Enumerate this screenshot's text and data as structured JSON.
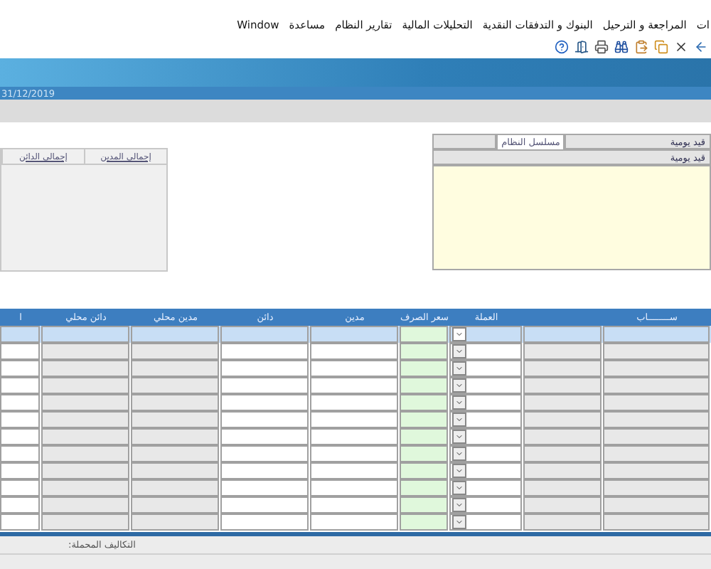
{
  "menu": [
    {
      "label": "ات"
    },
    {
      "label": "المراجعة و الترحيل"
    },
    {
      "label": "البنوك و التدفقات النقدية"
    },
    {
      "label": "التحليلات المالية"
    },
    {
      "label": "تقارير النظام"
    },
    {
      "label": "مساعدة"
    },
    {
      "label": "Window"
    }
  ],
  "toolbar": [
    {
      "kind": "back"
    },
    {
      "kind": "close"
    },
    {
      "kind": "copy"
    },
    {
      "kind": "paste"
    },
    {
      "kind": "find"
    },
    {
      "kind": "print"
    },
    {
      "kind": "exit"
    },
    {
      "kind": "help"
    }
  ],
  "date_strip": {
    "text": "31/12/2019"
  },
  "entry_panel": {
    "type_label": "قيد يومية",
    "tab": {
      "label": "مسلسل النظام",
      "selected": true
    },
    "type_value": "قيد يومية"
  },
  "totals_tabs": [
    {
      "label": "إجمالي المدين"
    },
    {
      "label": "إجمالي الدائن"
    }
  ],
  "table": {
    "columns": [
      {
        "label": "ســــــــاب",
        "kind": "gray"
      },
      {
        "kind": "gray"
      },
      {
        "label": "العملة",
        "kind": "select"
      },
      {
        "label": "سعر الصرف",
        "kind": "rate"
      },
      {
        "label": "مدين",
        "kind": "input"
      },
      {
        "label": "دائن",
        "kind": "input"
      },
      {
        "label": "مدين محلي",
        "kind": "gray"
      },
      {
        "label": "دائن محلي",
        "kind": "gray"
      },
      {
        "label": "ا",
        "kind": "input"
      }
    ],
    "rows": [
      {
        "selected": true
      },
      {
        "selected": false
      },
      {
        "selected": false
      },
      {
        "selected": false
      },
      {
        "selected": false
      },
      {
        "selected": false
      },
      {
        "selected": false
      },
      {
        "selected": false
      },
      {
        "selected": false
      },
      {
        "selected": false
      },
      {
        "selected": false
      },
      {
        "selected": false
      }
    ]
  },
  "footer": {
    "label": "التكاليف المحملة:"
  }
}
